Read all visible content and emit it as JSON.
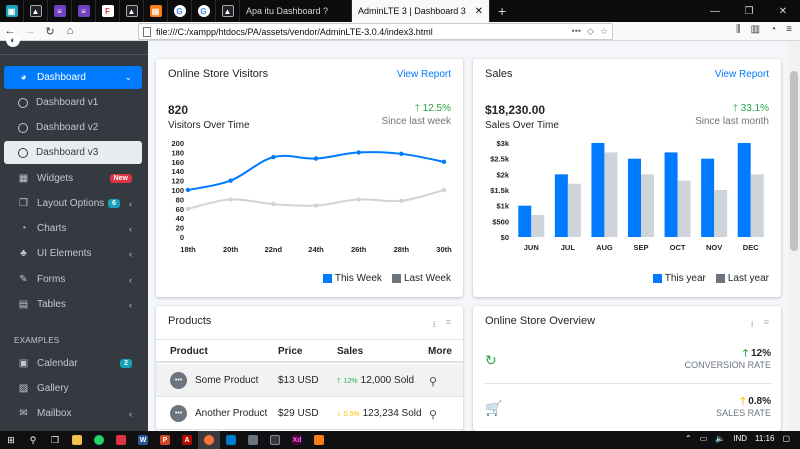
{
  "browser": {
    "tabs": [
      {
        "title": "Apa itu Dashboard ?"
      },
      {
        "title": "AdminLTE 3 | Dashboard 3"
      }
    ],
    "url": "file:///C:/xampp/htdocs/PA/assets/vendor/AdminLTE-3.0.4/index3.html",
    "menu_dots": "•••",
    "new_tab": "+"
  },
  "sidebar": {
    "items": [
      {
        "label": "Dashboard",
        "icon": "tachometer-icon"
      },
      {
        "label": "Dashboard v1",
        "icon": "circle-icon"
      },
      {
        "label": "Dashboard v2",
        "icon": "circle-icon"
      },
      {
        "label": "Dashboard v3",
        "icon": "circle-icon"
      },
      {
        "label": "Widgets",
        "icon": "th-icon",
        "badge": "New"
      },
      {
        "label": "Layout Options",
        "icon": "copy-icon",
        "badge": "6"
      },
      {
        "label": "Charts",
        "icon": "chart-pie-icon"
      },
      {
        "label": "UI Elements",
        "icon": "tree-icon"
      },
      {
        "label": "Forms",
        "icon": "edit-icon"
      },
      {
        "label": "Tables",
        "icon": "table-icon"
      },
      {
        "label": "Calendar",
        "icon": "calendar-icon",
        "badge": "2"
      },
      {
        "label": "Gallery",
        "icon": "image-icon"
      },
      {
        "label": "Mailbox",
        "icon": "envelope-icon"
      }
    ],
    "section_header": "EXAMPLES"
  },
  "visitors": {
    "title": "Online Store Visitors",
    "link": "View Report",
    "count": "820",
    "count_label": "Visitors Over Time",
    "delta": "12.5%",
    "delta_label": "Since last week",
    "legend_this": "This Week",
    "legend_last": "Last Week"
  },
  "sales": {
    "title": "Sales",
    "link": "View Report",
    "amount": "$18,230.00",
    "amount_label": "Sales Over Time",
    "delta": "33.1%",
    "delta_label": "Since last month",
    "legend_this": "This year",
    "legend_last": "Last year"
  },
  "chart_data": [
    {
      "type": "line",
      "x": [
        "18th",
        "20th",
        "22nd",
        "24th",
        "26th",
        "28th",
        "30th"
      ],
      "ylim": [
        0,
        200
      ],
      "yticks": [
        0,
        20,
        40,
        60,
        80,
        100,
        120,
        140,
        160,
        180,
        200
      ],
      "series": [
        {
          "name": "This Week",
          "values": [
            100,
            120,
            170,
            167,
            180,
            177,
            160
          ],
          "color": "#007bff"
        },
        {
          "name": "Last Week",
          "values": [
            60,
            80,
            70,
            67,
            80,
            77,
            100
          ],
          "color": "#ced4da"
        }
      ]
    },
    {
      "type": "bar",
      "categories": [
        "JUN",
        "JUL",
        "AUG",
        "SEP",
        "OCT",
        "NOV",
        "DEC"
      ],
      "ylim": [
        0,
        3000
      ],
      "yticks": [
        "$0",
        "$500",
        "$1k",
        "$1.5k",
        "$2k",
        "$2.5k",
        "$3k"
      ],
      "series": [
        {
          "name": "This year",
          "values": [
            1000,
            2000,
            3000,
            2500,
            2700,
            2500,
            3000
          ],
          "color": "#007bff"
        },
        {
          "name": "Last year",
          "values": [
            700,
            1700,
            2700,
            2000,
            1800,
            1500,
            2000
          ],
          "color": "#ced4da"
        }
      ]
    }
  ],
  "products": {
    "title": "Products",
    "columns": [
      "Product",
      "Price",
      "Sales",
      "More"
    ],
    "rows": [
      {
        "name": "Some Product",
        "price": "$13 USD",
        "pct": "12%",
        "sold": "12,000 Sold",
        "trend": "up"
      },
      {
        "name": "Another Product",
        "price": "$29 USD",
        "pct": "0.5%",
        "sold": "123,234 Sold",
        "trend": "down"
      }
    ]
  },
  "overview": {
    "title": "Online Store Overview",
    "rows": [
      {
        "value": "12%",
        "label": "CONVERSION RATE",
        "icon": "refresh-icon",
        "color": "#28a745",
        "trend_color": "#28a745"
      },
      {
        "value": "0.8%",
        "label": "SALES RATE",
        "icon": "shopping-cart-icon",
        "color": "#ffc107",
        "trend_color": "#ffc107"
      }
    ]
  },
  "taskbar": {
    "clock": "11:16",
    "lang": "IND"
  },
  "colors": {
    "primary": "#007bff",
    "success": "#28a745",
    "warning": "#ffc107",
    "danger": "#dc3545",
    "info": "#17a2b8",
    "sidebar": "#343a40"
  }
}
